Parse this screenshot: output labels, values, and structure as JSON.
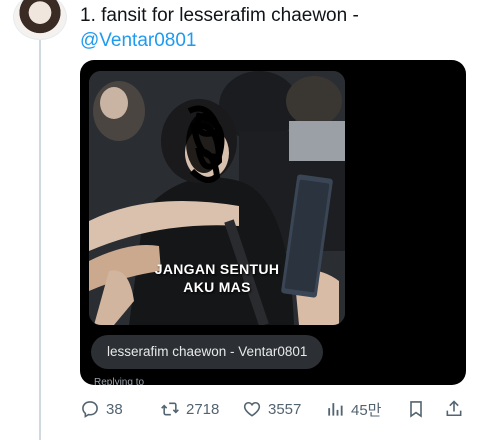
{
  "tweet": {
    "title": "1. fansit for lesserafim chaewon -",
    "handle": "@Ventar0801"
  },
  "media": {
    "caption_line1": "JANGAN SENTUH",
    "caption_line2": "AKU MAS",
    "label": "lesserafim chaewon - Ventar0801",
    "replying": "Replying to"
  },
  "actions": {
    "replies": "38",
    "retweets": "2718",
    "likes": "3557",
    "views": "45만"
  },
  "icons": {
    "reply": "reply-icon",
    "retweet": "retweet-icon",
    "like": "heart-icon",
    "views": "views-icon",
    "bookmark": "bookmark-icon",
    "share": "share-icon"
  },
  "colors": {
    "link": "#1d9bf0",
    "muted": "#536471",
    "media_bg": "#000000"
  }
}
